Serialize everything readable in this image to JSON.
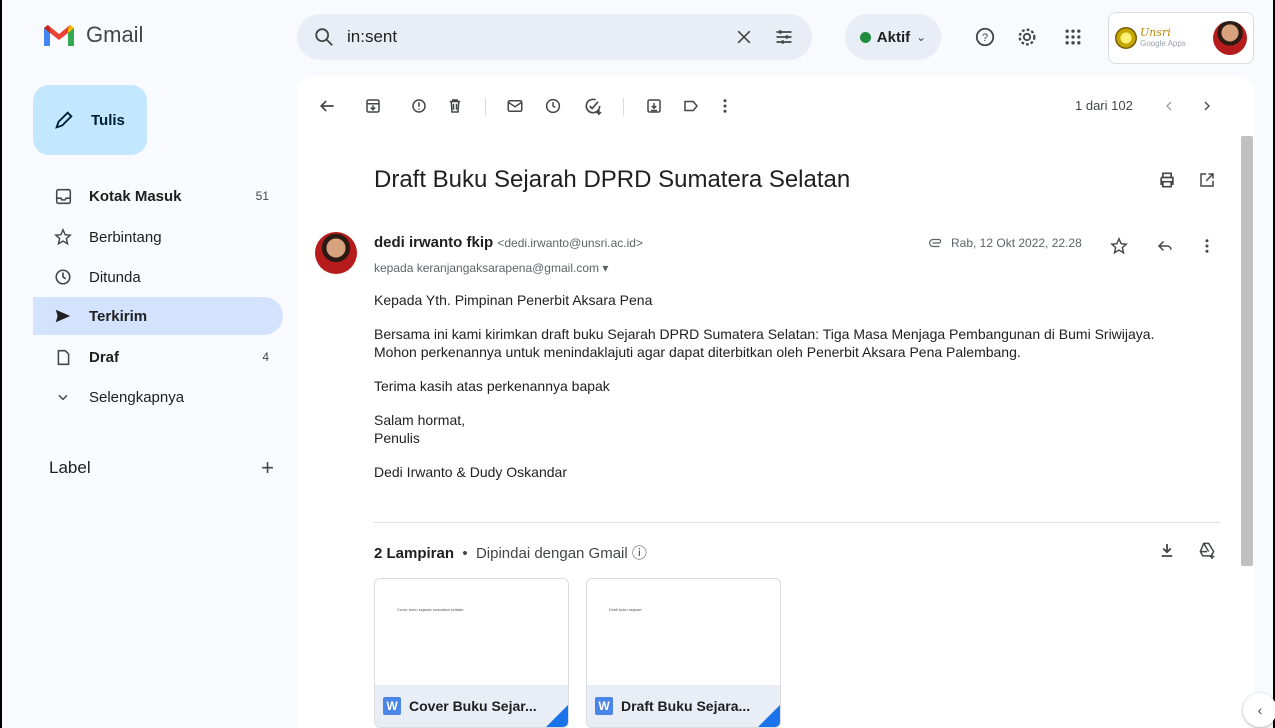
{
  "app": {
    "name": "Gmail"
  },
  "search": {
    "query": "in:sent"
  },
  "status": {
    "label": "Aktif"
  },
  "org_badge": {
    "name": "Unsri",
    "sub": "Google Apps"
  },
  "compose": {
    "label": "Tulis"
  },
  "nav": [
    {
      "label": "Kotak Masuk",
      "count": "51",
      "icon": "inbox-icon"
    },
    {
      "label": "Berbintang",
      "count": "",
      "icon": "star-icon"
    },
    {
      "label": "Ditunda",
      "count": "",
      "icon": "clock-icon"
    },
    {
      "label": "Terkirim",
      "count": "",
      "icon": "send-icon"
    },
    {
      "label": "Draf",
      "count": "4",
      "icon": "file-icon"
    },
    {
      "label": "Selengkapnya",
      "count": "",
      "icon": "chevron-down-icon"
    }
  ],
  "labels": {
    "title": "Label"
  },
  "pager": {
    "text": "1 dari 102"
  },
  "message": {
    "subject": "Draft Buku Sejarah DPRD Sumatera Selatan",
    "sender_name": "dedi irwanto fkip",
    "sender_email": "<dedi.irwanto@unsri.ac.id>",
    "to": "kepada keranjangaksarapena@gmail.com ▾",
    "date": "Rab, 12 Okt 2022, 22.28",
    "greeting": "Kepada Yth. Pimpinan Penerbit Aksara Pena",
    "para1a": "Bersama ini kami kirimkan draft buku Sejarah DPRD Sumatera Selatan: Tiga Masa Menjaga Pembangunan di Bumi Sriwijaya.",
    "para1b": "Mohon perkenannya untuk menindaklajuti agar dapat diterbitkan oleh Penerbit Aksara Pena Palembang.",
    "thanks": "Terima kasih atas perkenannya bapak",
    "closing1": "Salam hormat,",
    "closing2": "Penulis",
    "signature": "Dedi Irwanto & Dudy Oskandar"
  },
  "attachments": {
    "count_label": "2 Lampiran",
    "scan_label": "Dipindai dengan Gmail",
    "items": [
      {
        "name": "Cover Buku Sejar...",
        "preview": "Cover buku sejarah sumatera selatan"
      },
      {
        "name": "Draft Buku Sejara...",
        "preview": "Draft buku sejarah"
      }
    ]
  },
  "colors": {
    "compose_bg": "#c2e7ff",
    "active_nav": "#d3e3fd",
    "status_green": "#1e8e3e",
    "search_bg": "#e9eef6"
  }
}
